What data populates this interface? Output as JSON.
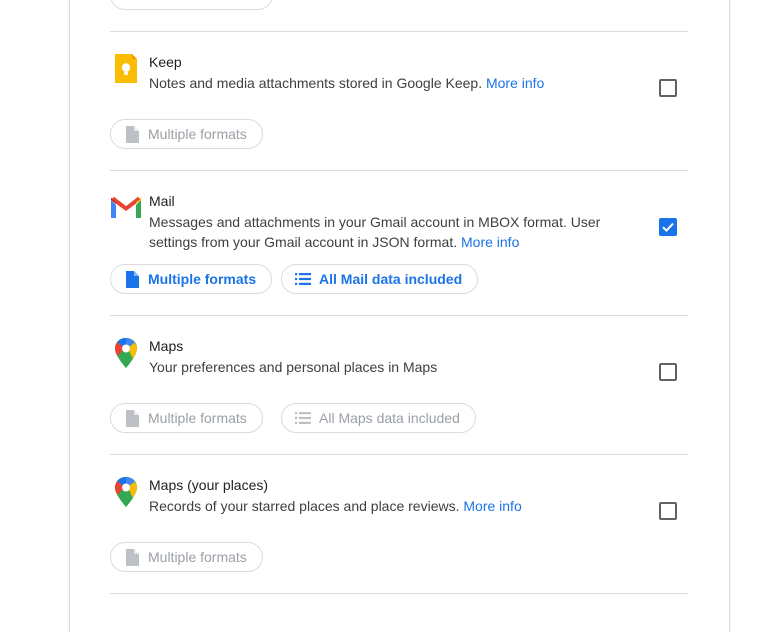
{
  "products": [
    {
      "id": "keep",
      "title": "Keep",
      "description": "Notes and media attachments stored in Google Keep.",
      "more_info": "More info",
      "checked": false,
      "chips": [
        {
          "label": "Multiple formats",
          "state": "disabled",
          "icon": "file-icon"
        }
      ]
    },
    {
      "id": "mail",
      "title": "Mail",
      "description_line1": "Messages and attachments in your Gmail account in MBOX format. User",
      "description_line2": "settings from your Gmail account in JSON format.",
      "more_info": "More info",
      "checked": true,
      "chips": [
        {
          "label": "Multiple formats",
          "state": "active",
          "icon": "file-icon"
        },
        {
          "label": "All Mail data included",
          "state": "active",
          "icon": "list-icon"
        }
      ]
    },
    {
      "id": "maps",
      "title": "Maps",
      "description": "Your preferences and personal places in Maps",
      "checked": false,
      "chips": [
        {
          "label": "Multiple formats",
          "state": "disabled",
          "icon": "file-icon"
        },
        {
          "label": "All Maps data included",
          "state": "disabled",
          "icon": "list-icon"
        }
      ]
    },
    {
      "id": "maps-places",
      "title": "Maps (your places)",
      "description": "Records of your starred places and place reviews.",
      "more_info": "More info",
      "checked": false,
      "chips": [
        {
          "label": "Multiple formats",
          "state": "disabled",
          "icon": "file-icon"
        }
      ]
    }
  ],
  "colors": {
    "accent": "#1a73e8",
    "disabled": "#9aa0a6",
    "divider": "#dadce0"
  }
}
